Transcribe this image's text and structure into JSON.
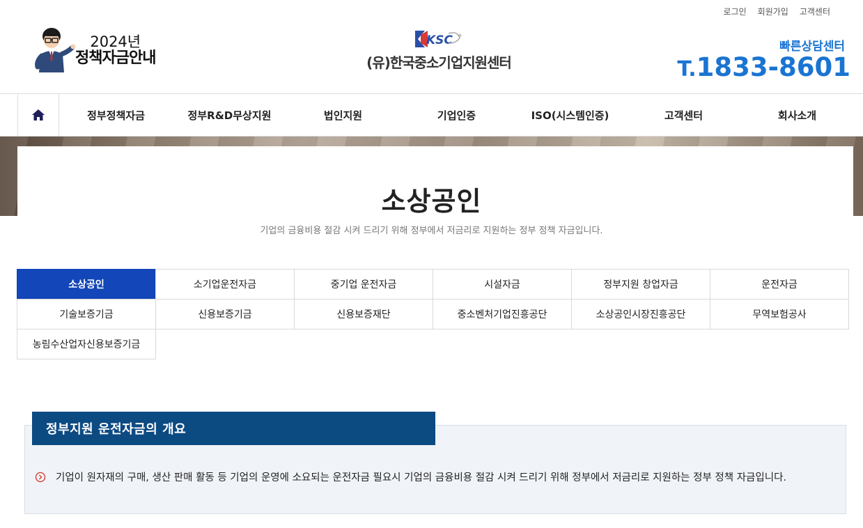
{
  "util_links": [
    "로그인",
    "회원가입",
    "고객센터"
  ],
  "brand": {
    "year": "2024년",
    "sub": "정책자금안내",
    "center_name": "(유)한국중소기업지원센터",
    "logo_text": "KSC"
  },
  "consult": {
    "label": "빠른상담센터",
    "phone_prefix": "T.",
    "phone": "1833-8601"
  },
  "nav": [
    "정부정책자금",
    "정부R&D무상지원",
    "법인지원",
    "기업인증",
    "ISO(시스템인증)",
    "고객센터",
    "회사소개"
  ],
  "hero": {
    "title": "소상공인",
    "desc": "기업의 금융비용 절감 시켜 드리기 위해 정부에서 저금리로 지원하는 정부 정책 자금입니다."
  },
  "tabs": {
    "row1": [
      "소상공인",
      "소기업운전자금",
      "중기업 운전자금",
      "시설자금",
      "정부지원 창업자금",
      "운전자금"
    ],
    "row2": [
      "기술보증기금",
      "신용보증기금",
      "신용보증재단",
      "중소벤처기업진흥공단",
      "소상공인시장진흥공단",
      "무역보험공사"
    ],
    "row3": [
      "농림수산업자신용보증기금"
    ],
    "active": "소상공인"
  },
  "info": {
    "heading": "정부지원 운전자금의 개요",
    "text": "기업이 원자재의 구매, 생산 판매 활동 등 기업의 운영에 소요되는 운전자금 필요시 기업의 금융비용 절감 시켜 드리기 위해 정부에서 저금리로 지원하는 정부 정책 자금입니다."
  },
  "colors": {
    "accent_blue": "#1a74d2",
    "active_tab": "#1346b8",
    "info_head": "#0c4a82",
    "bullet_red": "#d93025"
  }
}
